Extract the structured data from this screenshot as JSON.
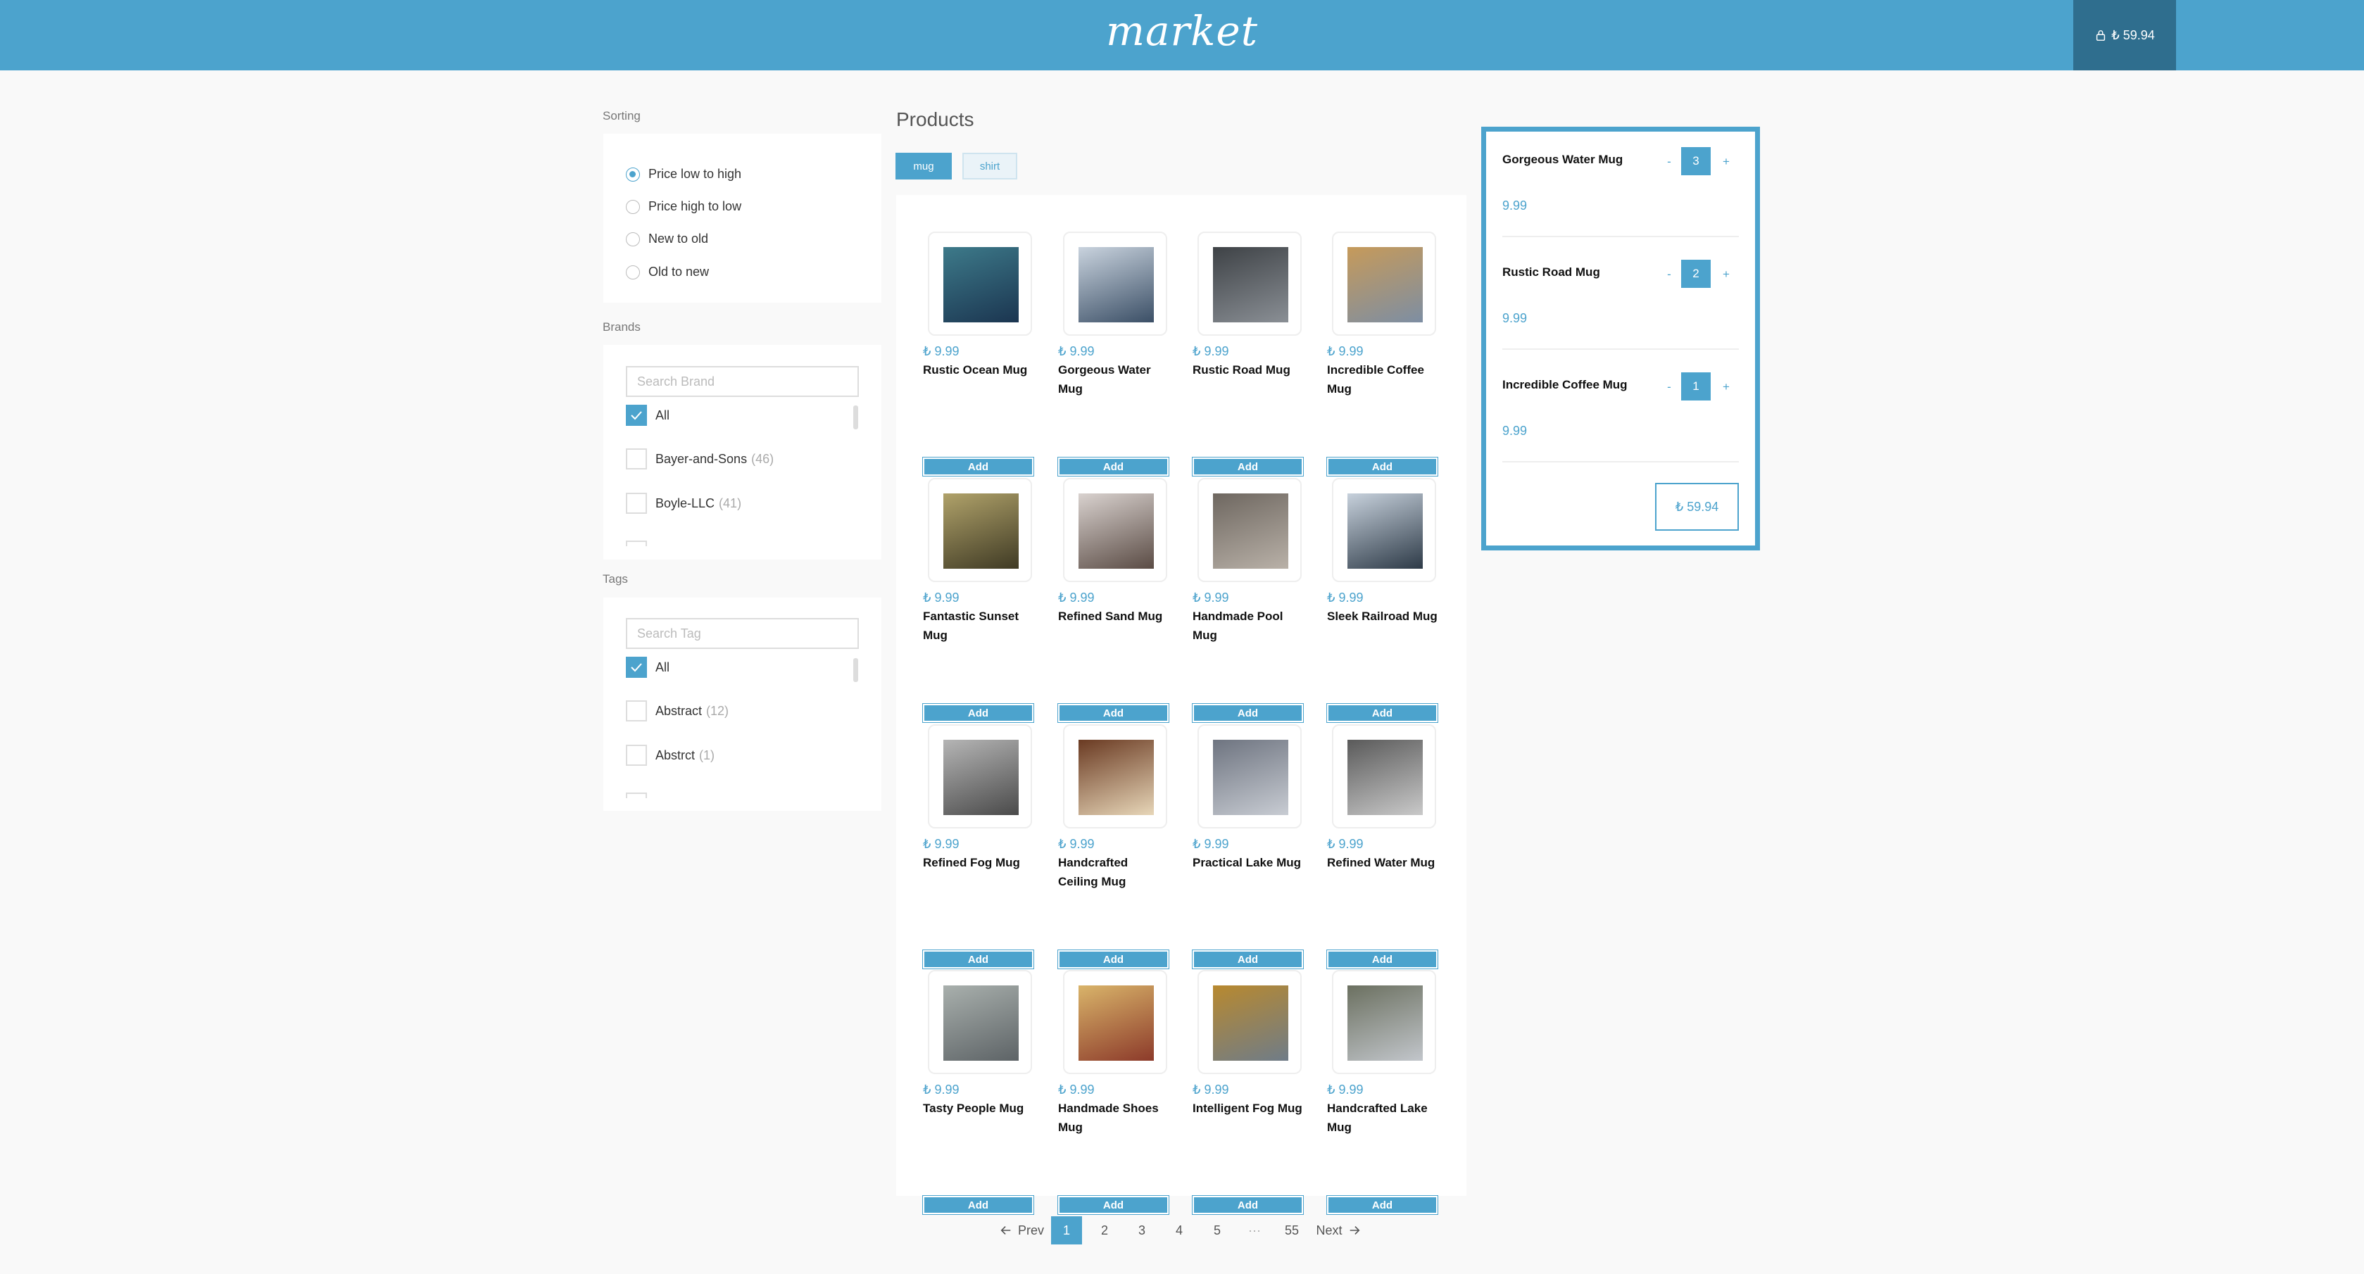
{
  "header": {
    "logo": "market",
    "basket_total": "₺ 59.94"
  },
  "sidebar": {
    "sorting": {
      "title": "Sorting",
      "options": [
        "Price low to high",
        "Price high to low",
        "New to old",
        "Old to new"
      ],
      "selected": "Price low to high"
    },
    "brands": {
      "title": "Brands",
      "search_placeholder": "Search Brand",
      "items": [
        {
          "label": "All",
          "count": "",
          "checked": true
        },
        {
          "label": "Bayer-and-Sons",
          "count": "(46)",
          "checked": false
        },
        {
          "label": "Boyle-LLC",
          "count": "(41)",
          "checked": false
        }
      ]
    },
    "tags": {
      "title": "Tags",
      "search_placeholder": "Search Tag",
      "items": [
        {
          "label": "All",
          "count": "",
          "checked": true
        },
        {
          "label": "Abstract",
          "count": "(12)",
          "checked": false
        },
        {
          "label": "Abstrct",
          "count": "(1)",
          "checked": false
        }
      ]
    }
  },
  "products": {
    "title": "Products",
    "type_tabs": [
      {
        "label": "mug",
        "active": true
      },
      {
        "label": "shirt",
        "active": false
      }
    ],
    "add_label": "Add",
    "items": [
      {
        "price": "₺ 9.99",
        "name": "Rustic Ocean Mug"
      },
      {
        "price": "₺ 9.99",
        "name": "Gorgeous Water Mug"
      },
      {
        "price": "₺ 9.99",
        "name": "Rustic Road Mug"
      },
      {
        "price": "₺ 9.99",
        "name": "Incredible Coffee Mug"
      },
      {
        "price": "₺ 9.99",
        "name": "Fantastic Sunset Mug"
      },
      {
        "price": "₺ 9.99",
        "name": "Refined Sand Mug"
      },
      {
        "price": "₺ 9.99",
        "name": "Handmade Pool Mug"
      },
      {
        "price": "₺ 9.99",
        "name": "Sleek Railroad Mug"
      },
      {
        "price": "₺ 9.99",
        "name": "Refined Fog Mug"
      },
      {
        "price": "₺ 9.99",
        "name": "Handcrafted Ceiling Mug"
      },
      {
        "price": "₺ 9.99",
        "name": "Practical Lake Mug"
      },
      {
        "price": "₺ 9.99",
        "name": "Refined Water Mug"
      },
      {
        "price": "₺ 9.99",
        "name": "Tasty People Mug"
      },
      {
        "price": "₺ 9.99",
        "name": "Handmade Shoes Mug"
      },
      {
        "price": "₺ 9.99",
        "name": "Intelligent Fog Mug"
      },
      {
        "price": "₺ 9.99",
        "name": "Handcrafted Lake Mug"
      }
    ],
    "thumb_colors": [
      [
        "#1b3550",
        "#3d7a8a"
      ],
      [
        "#3b4f66",
        "#c9d3de"
      ],
      [
        "#8a8f95",
        "#3e4246"
      ],
      [
        "#7d8ea3",
        "#c69a5a"
      ],
      [
        "#3f3a24",
        "#b0a26a"
      ],
      [
        "#5a4b44",
        "#d9d2cf"
      ],
      [
        "#b9b1a8",
        "#6e6760"
      ],
      [
        "#2d3a47",
        "#c7d1dc"
      ],
      [
        "#4a4a4a",
        "#b5b5b5"
      ],
      [
        "#e7d6b8",
        "#6a3a22"
      ],
      [
        "#c8ccd3",
        "#6e7480"
      ],
      [
        "#c9c9c9",
        "#5a5a5a"
      ],
      [
        "#5d6366",
        "#a9b0ad"
      ],
      [
        "#8c3a2a",
        "#d9b46a"
      ],
      [
        "#6f7c88",
        "#b8892f"
      ],
      [
        "#c2c6cb",
        "#6b7060"
      ]
    ]
  },
  "pagination": {
    "prev": "Prev",
    "pages": [
      "1",
      "2",
      "3",
      "4",
      "5",
      "···",
      "55"
    ],
    "current": "1",
    "next": "Next"
  },
  "cart": {
    "items": [
      {
        "name": "Gorgeous Water Mug",
        "qty": "3",
        "price": "9.99"
      },
      {
        "name": "Rustic Road Mug",
        "qty": "2",
        "price": "9.99"
      },
      {
        "name": "Incredible Coffee Mug",
        "qty": "1",
        "price": "9.99"
      }
    ],
    "minus": "-",
    "plus": "+",
    "total": "₺ 59.94"
  },
  "colors": {
    "accent": "#4ca3cd",
    "accent_dark": "#2f6e8e"
  }
}
